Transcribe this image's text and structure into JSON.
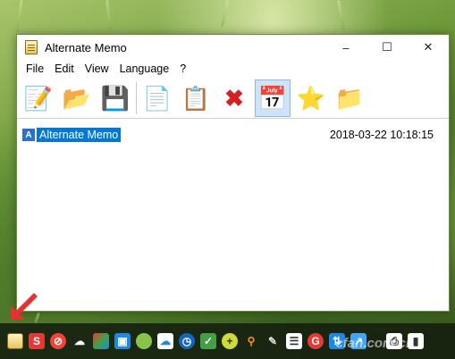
{
  "window": {
    "title": "Alternate Memo",
    "minimize_icon": "minimize-icon",
    "maximize_icon": "maximize-icon",
    "close_icon": "close-icon"
  },
  "menu": {
    "items": [
      "File",
      "Edit",
      "View",
      "Language",
      "?"
    ]
  },
  "toolbar": {
    "buttons": [
      {
        "icon": "new-memo-icon",
        "glyph": "📝"
      },
      {
        "icon": "open-folder-icon",
        "glyph": "📂"
      },
      {
        "icon": "save-icon",
        "glyph": "💾"
      },
      {
        "icon": "copy-icon",
        "glyph": "📄"
      },
      {
        "icon": "paste-icon",
        "glyph": "📋"
      },
      {
        "icon": "delete-icon",
        "glyph": "✖"
      },
      {
        "icon": "calendar-icon",
        "glyph": "📅"
      },
      {
        "icon": "favorite-star-icon",
        "glyph": "⭐"
      },
      {
        "icon": "new-folder-icon",
        "glyph": "📁"
      }
    ]
  },
  "memos": [
    {
      "name": "Alternate Memo",
      "date": "2018-03-22 10:18:15",
      "icon_letter": "A"
    }
  ],
  "taskbar": {
    "icons": [
      "memo-app-icon",
      "sogou-icon",
      "block-icon",
      "cloud-icon",
      "color-tool-icon",
      "screen-tool-icon",
      "chat-icon",
      "cloud-drive-icon",
      "clock-icon",
      "shield-icon",
      "add-icon",
      "search-icon",
      "pen-icon",
      "notes-icon",
      "browser-icon",
      "network-icon",
      "remote-icon",
      "print-icon",
      "monitor-icon"
    ],
    "watermark": "cfan.com.cn"
  },
  "colors": {
    "selection": "#0078d7",
    "arrow": "#e63131"
  }
}
